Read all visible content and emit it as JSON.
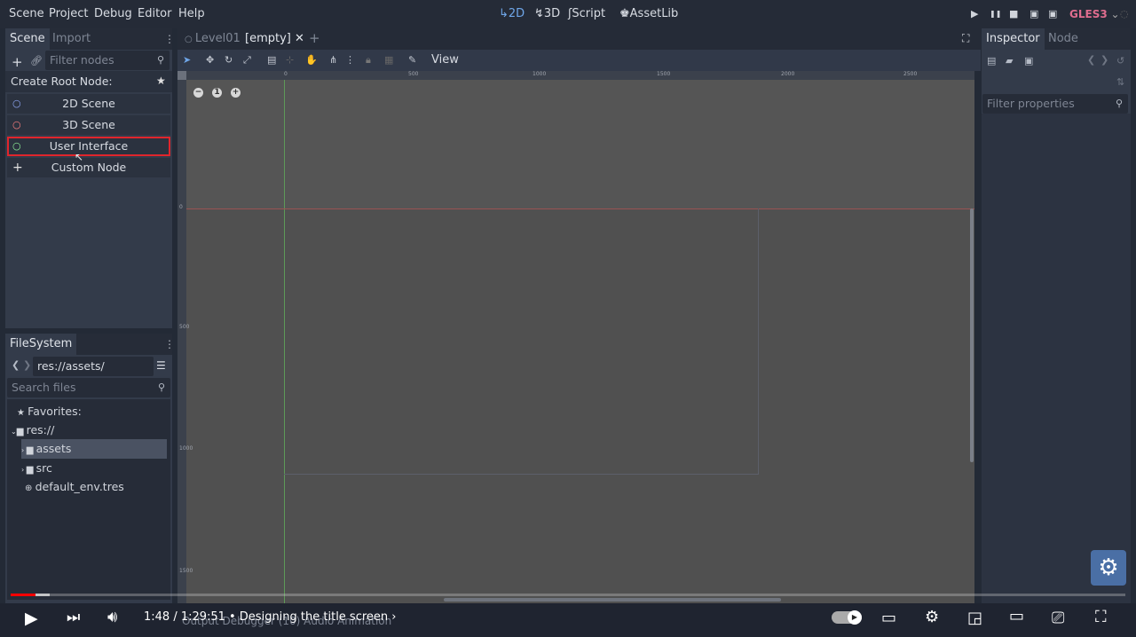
{
  "menu": [
    "Scene",
    "Project",
    "Debug",
    "Editor",
    "Help"
  ],
  "workspaces": [
    {
      "icon": "2d-icon",
      "label": "2D"
    },
    {
      "icon": "3d-icon",
      "label": "3D"
    },
    {
      "icon": "script-icon",
      "label": "Script"
    },
    {
      "icon": "assetlib-icon",
      "label": "AssetLib"
    }
  ],
  "play_controls": [
    "▶",
    "❚❚",
    "■",
    "▣",
    "▣"
  ],
  "renderer": "GLES3",
  "scene_panel": {
    "tabs": [
      "Scene",
      "Import"
    ],
    "filter_placeholder": "Filter nodes",
    "create_root_label": "Create Root Node:",
    "root_options": [
      {
        "label": "2D Scene",
        "icon": "circle-icon",
        "color": "#8da5f3"
      },
      {
        "label": "3D Scene",
        "icon": "circle-icon",
        "color": "#fc7f7f"
      },
      {
        "label": "User Interface",
        "icon": "circle-icon",
        "color": "#8eef97"
      },
      {
        "label": "Custom Node",
        "icon": "plus-icon",
        "color": "#e0e0e0"
      }
    ]
  },
  "filesystem": {
    "tab": "FileSystem",
    "path": "res://assets/",
    "search_placeholder": "Search files",
    "favorites": "Favorites:",
    "root": "res://",
    "items": [
      "assets",
      "src",
      "default_env.tres"
    ]
  },
  "editor": {
    "tabs": [
      "Level01",
      "[empty]"
    ],
    "view_menu": "View",
    "ruler_h": [
      "0",
      "500",
      "1000",
      "1500",
      "2000",
      "2500"
    ],
    "ruler_v": [
      "0",
      "500",
      "1000",
      "1500"
    ]
  },
  "inspector": {
    "tabs": [
      "Inspector",
      "Node"
    ],
    "filter_placeholder": "Filter properties"
  },
  "bottom_tabs": "Output   Debugger (10)   Audio   Animation",
  "video": {
    "time": "1:48 / 1:29:51",
    "chapter": "• Designing the title screen ›",
    "progress_fraction": 0.02
  },
  "colors": {
    "accent": "#6fa6e8",
    "selection_outline": "#e0252c",
    "renderer": "#e06d8f",
    "progress": "#ff0000"
  }
}
